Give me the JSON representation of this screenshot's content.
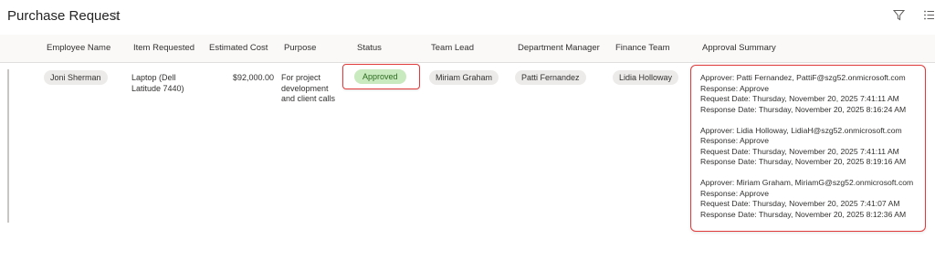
{
  "page": {
    "title": "Purchase Request",
    "icons": {
      "favorite": "star-icon",
      "filter": "filter-icon",
      "view": "view-options-icon"
    }
  },
  "columns": [
    "Employee Name",
    "Item Requested",
    "Estimated Cost",
    "Purpose",
    "Status",
    "Team Lead",
    "Department Manager",
    "Finance Team",
    "Approval Summary"
  ],
  "row": {
    "employee_name": "Joni Sherman",
    "item_requested": [
      "Laptop (Dell",
      "Latitude 7440)"
    ],
    "estimated_cost": "$92,000.00",
    "purpose": [
      "For project",
      "development",
      "and client calls"
    ],
    "status": "Approved",
    "team_lead": "Miriam Graham",
    "department_manager": "Patti Fernandez",
    "finance_team": "Lidia Holloway",
    "approval_summary": [
      [
        "Approver: Patti Fernandez, PattiF@szg52.onmicrosoft.com",
        "Response: Approve",
        "Request Date: Thursday, November 20, 2025 7:41:11 AM",
        "Response Date: Thursday, November 20, 2025 8:16:24 AM"
      ],
      [
        "Approver: Lidia Holloway, LidiaH@szg52.onmicrosoft.com",
        "Response: Approve",
        "Request Date: Thursday, November 20, 2025 7:41:11 AM",
        "Response Date: Thursday, November 20, 2025 8:19:16 AM"
      ],
      [
        "Approver: Miriam Graham, MiriamG@szg52.onmicrosoft.com",
        "Response: Approve",
        "Request Date: Thursday, November 20, 2025 7:41:07 AM",
        "Response Date: Thursday, November 20, 2025 8:12:36 AM"
      ]
    ]
  },
  "colors": {
    "status_approved_bg": "#c9eabf",
    "status_approved_text": "#2d6b20",
    "highlight_border": "#e03a3a",
    "pill_bg": "#edebe9"
  }
}
